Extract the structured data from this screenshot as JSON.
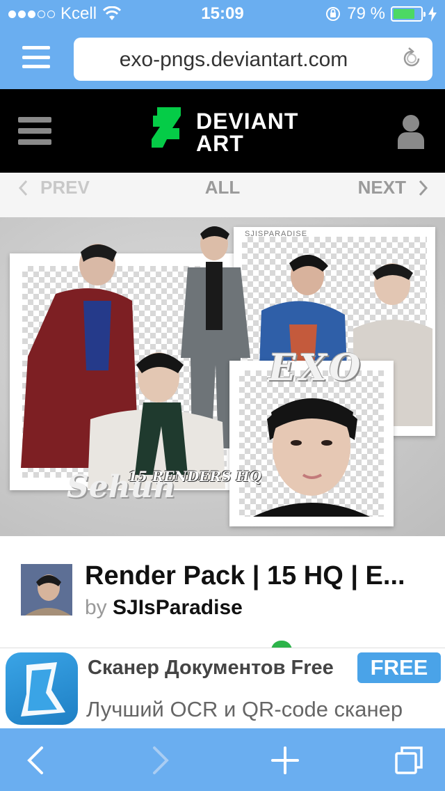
{
  "status_bar": {
    "carrier": "Kcell",
    "time": "15:09",
    "battery_percent": "79 %",
    "battery_level": 0.79,
    "signal_bars_filled": 3,
    "signal_bars_total": 5
  },
  "address_bar": {
    "url": "exo-pngs.deviantart.com"
  },
  "header": {
    "logo_line1": "DEVIANT",
    "logo_line2": "ART"
  },
  "nav": {
    "prev_label": "PREV",
    "all_label": "ALL",
    "next_label": "NEXT"
  },
  "artwork": {
    "text_exo": "EXO",
    "text_sehun": "Sehun",
    "text_renders": "15 RENDERS HQ",
    "text_credit": "SJISPARADISE"
  },
  "deviation": {
    "title": "Render Pack | 15 HQ | E...",
    "by_label": "by",
    "author": "SJIsParadise"
  },
  "ad": {
    "title": "Сканер Документов Free",
    "badge": "FREE",
    "subtitle": "Лучший OCR и QR-code сканер"
  },
  "colors": {
    "browser_chrome": "#6aaef0",
    "deviantart_green": "#05cc47",
    "battery_green": "#4cd964",
    "ad_blue": "#4aa3e8"
  },
  "icons": [
    "wifi-icon",
    "orientation-lock-icon",
    "charging-icon",
    "hamburger-icon",
    "reload-icon",
    "deviantart-logo-icon",
    "user-icon",
    "chevron-left-icon",
    "chevron-right-icon",
    "back-icon",
    "forward-icon",
    "add-icon",
    "tabs-icon"
  ]
}
